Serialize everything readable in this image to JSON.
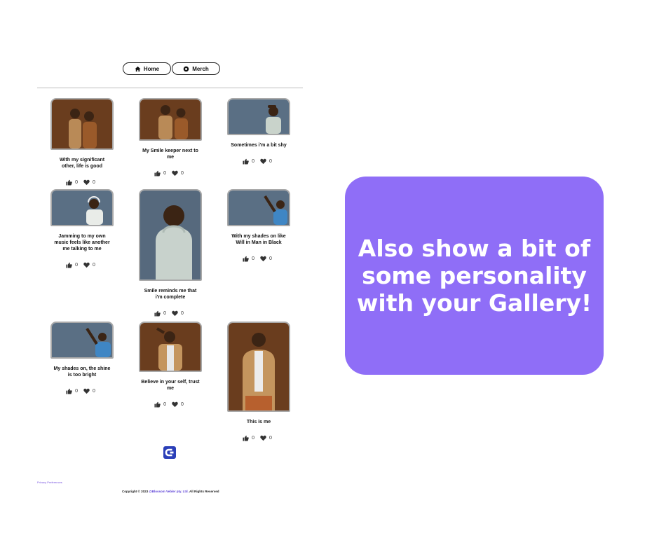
{
  "nav": {
    "home_label": "Home",
    "merch_label": "Merch"
  },
  "gallery": [
    {
      "caption": "With my significant other, life is good",
      "likes": "0",
      "hearts": "0",
      "bg": "#6a3d1e"
    },
    {
      "caption": "My Smile keeper next to me",
      "likes": "0",
      "hearts": "0",
      "bg": "#6a3d1e"
    },
    {
      "caption": "Sometimes i'm a bit shy",
      "likes": "0",
      "hearts": "0",
      "bg": "#5a6f84"
    },
    {
      "caption": "Jamming to my own music feels like another me talking to me",
      "likes": "0",
      "hearts": "0",
      "bg": "#5a6f84"
    },
    {
      "caption": "Smile reminds me that i'm complete",
      "likes": "0",
      "hearts": "0",
      "bg": "#56697d"
    },
    {
      "caption": "With my shades on like Will in Man in Black",
      "likes": "0",
      "hearts": "0",
      "bg": "#5a6f84"
    },
    {
      "caption": "My shades on, the shine is too bright",
      "likes": "0",
      "hearts": "0",
      "bg": "#5a6f84"
    },
    {
      "caption": "Believe in your self, trust me",
      "likes": "0",
      "hearts": "0",
      "bg": "#6a3d1e"
    },
    {
      "caption": "This is me",
      "likes": "0",
      "hearts": "0",
      "bg": "#6a3d1e"
    }
  ],
  "footer": {
    "privacy": "Privacy Preferences",
    "copyright_prefix": "Copyright © 2023",
    "copyright_link": "@Blossom Vebler pty. Ltd.",
    "copyright_suffix": "All Rights Reserved"
  },
  "promo": {
    "text": "Also show a bit of some personality with your Gallery!",
    "bg_color": "#8f6ef7"
  }
}
